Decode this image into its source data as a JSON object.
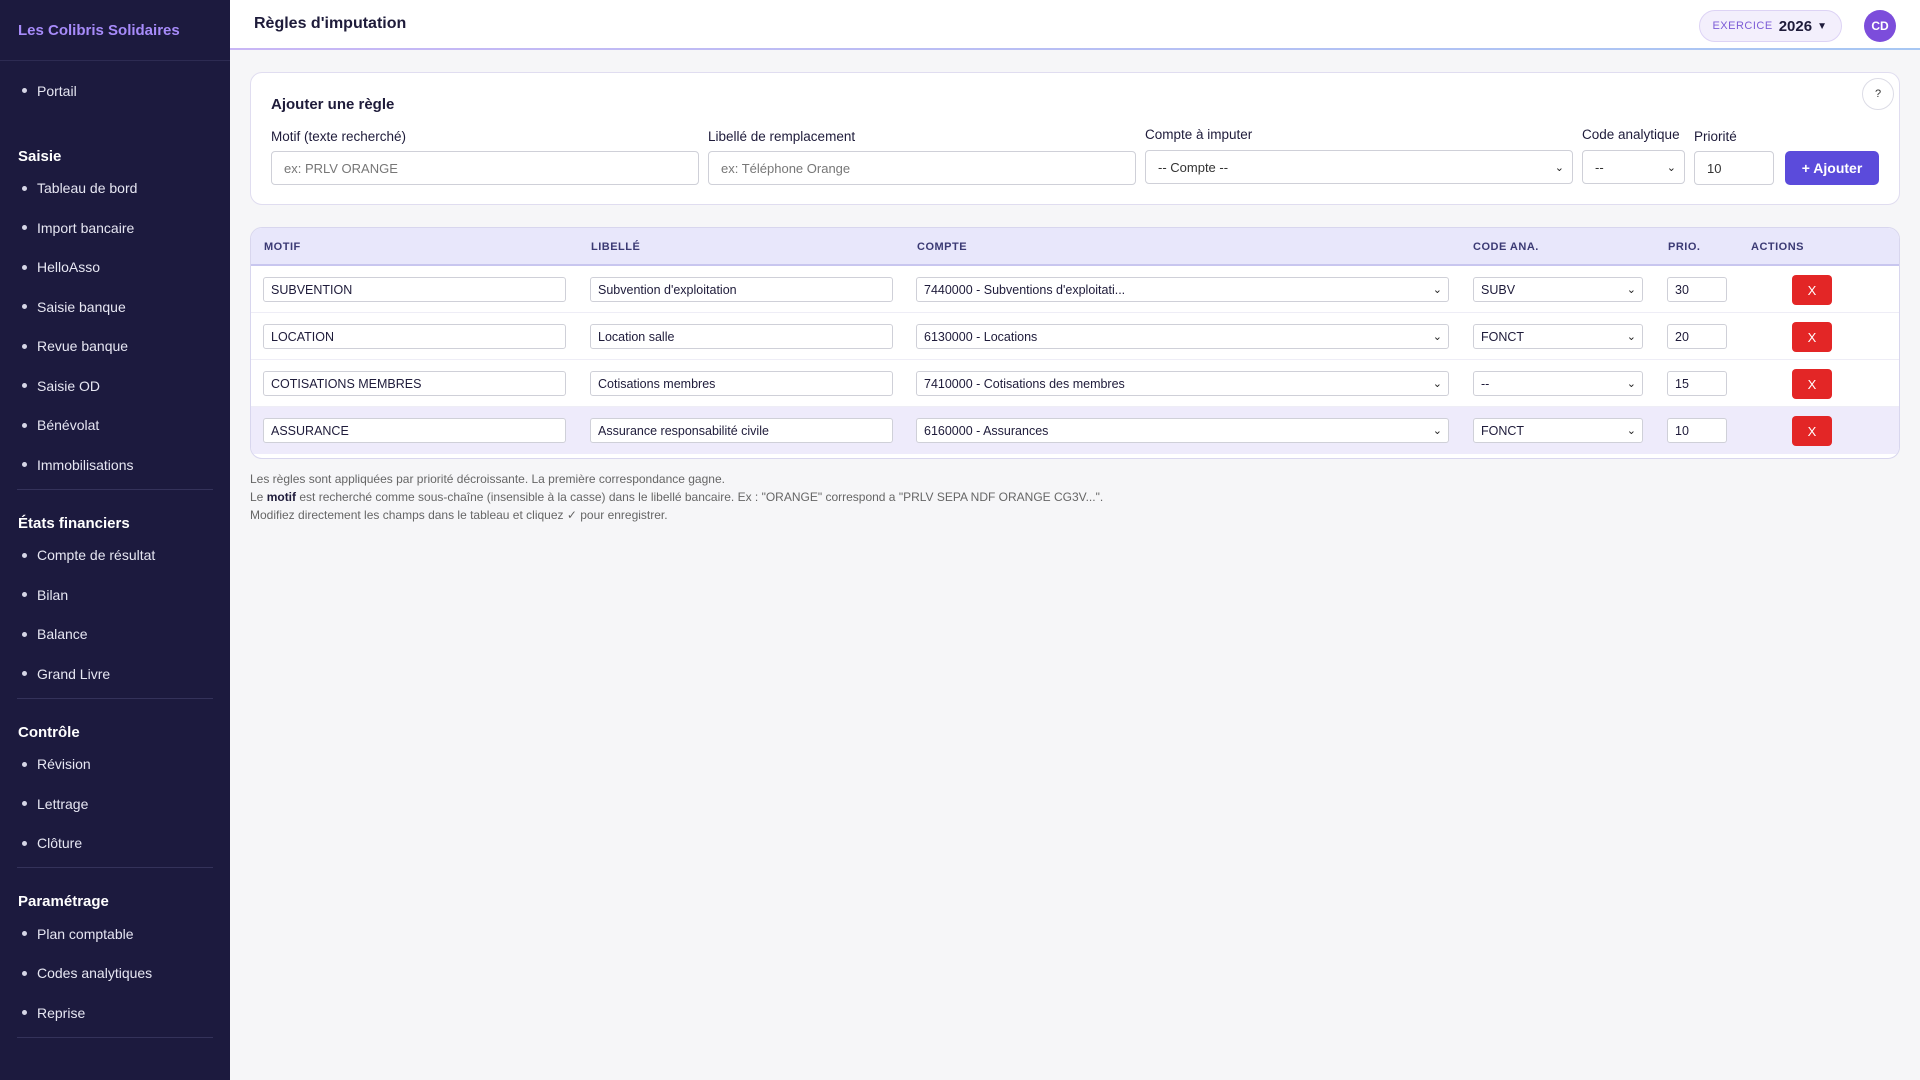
{
  "sidebar": {
    "brand": "Les Colibris Solidaires",
    "top_items": [
      {
        "label": "Portail"
      }
    ],
    "sections": [
      {
        "title": "Saisie",
        "items": [
          {
            "label": "Tableau de bord"
          },
          {
            "label": "Import bancaire"
          },
          {
            "label": "HelloAsso"
          },
          {
            "label": "Saisie banque"
          },
          {
            "label": "Revue banque"
          },
          {
            "label": "Saisie OD"
          },
          {
            "label": "Bénévolat"
          },
          {
            "label": "Immobilisations"
          }
        ]
      },
      {
        "title": "États financiers",
        "items": [
          {
            "label": "Compte de résultat"
          },
          {
            "label": "Bilan"
          },
          {
            "label": "Balance"
          },
          {
            "label": "Grand Livre"
          }
        ]
      },
      {
        "title": "Contrôle",
        "items": [
          {
            "label": "Révision"
          },
          {
            "label": "Lettrage"
          },
          {
            "label": "Clôture"
          }
        ]
      },
      {
        "title": "Paramétrage",
        "items": [
          {
            "label": "Plan comptable"
          },
          {
            "label": "Codes analytiques"
          },
          {
            "label": "Reprise"
          }
        ]
      }
    ]
  },
  "header": {
    "title": "Règles d'imputation",
    "exercise_label": "EXERCICE",
    "exercise_year": "2026",
    "avatar": "CD"
  },
  "form": {
    "title": "Ajouter une règle",
    "help": "?",
    "motif_label": "Motif (texte recherché)",
    "motif_placeholder": "ex: PRLV ORANGE",
    "libelle_label": "Libellé de remplacement",
    "libelle_placeholder": "ex: Téléphone Orange",
    "compte_label": "Compte à imputer",
    "compte_value": "-- Compte --",
    "code_label": "Code analytique",
    "code_value": "--",
    "priorite_label": "Priorité",
    "priorite_value": "10",
    "add_label": "+ Ajouter"
  },
  "table": {
    "headers": {
      "motif": "MOTIF",
      "libelle": "LIBELLÉ",
      "compte": "COMPTE",
      "code": "CODE ANA.",
      "prio": "PRIO.",
      "actions": "ACTIONS"
    },
    "rows": [
      {
        "motif": "SUBVENTION",
        "libelle": "Subvention d'exploitation",
        "compte": "7440000 - Subventions d'exploitati...",
        "code": "SUBV",
        "prio": "30",
        "delete": "X"
      },
      {
        "motif": "LOCATION",
        "libelle": "Location salle",
        "compte": "6130000 - Locations",
        "code": "FONCT",
        "prio": "20",
        "delete": "X"
      },
      {
        "motif": "COTISATIONS MEMBRES",
        "libelle": "Cotisations membres",
        "compte": "7410000 - Cotisations des membres",
        "code": "--",
        "prio": "15",
        "delete": "X"
      },
      {
        "motif": "ASSURANCE",
        "libelle": "Assurance responsabilité civile",
        "compte": "6160000 - Assurances",
        "code": "FONCT",
        "prio": "10",
        "delete": "X"
      }
    ]
  },
  "notes": {
    "line1": "Les règles sont appliquées par priorité décroissante. La première correspondance gagne.",
    "line2_prefix": "Le ",
    "line2_bold": "motif",
    "line2_suffix": " est recherché comme sous-chaîne (insensible à la casse) dans le libellé bancaire. Ex : \"ORANGE\" correspond a \"PRLV SEPA NDF ORANGE CG3V...\".",
    "line3": "Modifiez directement les champs dans le tableau et cliquez ✓ pour enregistrer."
  }
}
